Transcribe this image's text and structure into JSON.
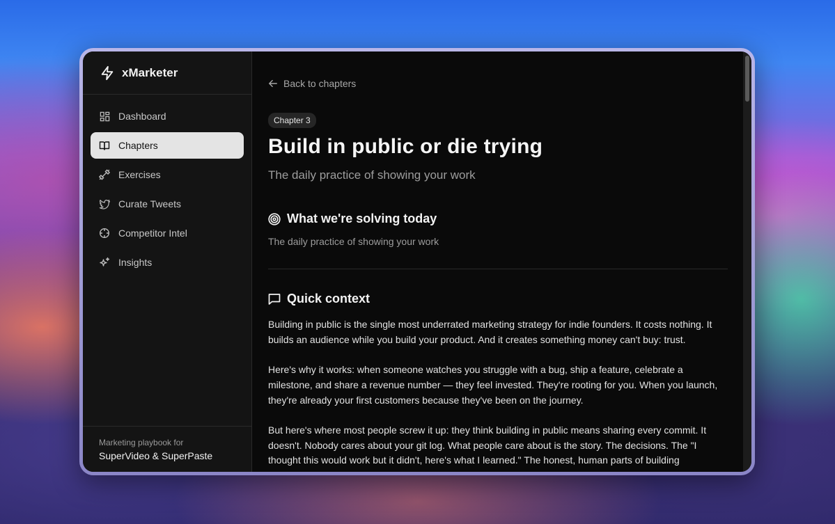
{
  "app": {
    "name": "xMarketer"
  },
  "sidebar": {
    "items": [
      {
        "label": "Dashboard",
        "icon": "dashboard-icon",
        "active": false
      },
      {
        "label": "Chapters",
        "icon": "book-icon",
        "active": true
      },
      {
        "label": "Exercises",
        "icon": "dumbbell-icon",
        "active": false
      },
      {
        "label": "Curate Tweets",
        "icon": "twitter-icon",
        "active": false
      },
      {
        "label": "Competitor Intel",
        "icon": "crosshair-icon",
        "active": false
      },
      {
        "label": "Insights",
        "icon": "sparkles-icon",
        "active": false
      }
    ],
    "footer": {
      "caption": "Marketing playbook for",
      "product": "SuperVideo & SuperPaste"
    }
  },
  "main": {
    "back_label": "Back to chapters",
    "chapter_badge": "Chapter 3",
    "title": "Build in public or die trying",
    "subtitle": "The daily practice of showing your work",
    "solving": {
      "heading": "What we're solving today",
      "text": "The daily practice of showing your work"
    },
    "context": {
      "heading": "Quick context",
      "paragraphs": [
        "Building in public is the single most underrated marketing strategy for indie founders. It costs nothing. It builds an audience while you build your product. And it creates something money can't buy: trust.",
        "Here's why it works: when someone watches you struggle with a bug, ship a feature, celebrate a milestone, and share a revenue number — they feel invested. They're rooting for you. When you launch, they're already your first customers because they've been on the journey.",
        "But here's where most people screw it up: they think building in public means sharing every commit. It doesn't. Nobody cares about your git log. What people care about is the story. The decisions. The \"I thought this would work but it didn't, here's what I learned.\" The honest, human parts of building something."
      ]
    }
  },
  "colors": {
    "window_bg": "#0a0a0a",
    "sidebar_bg": "#141414",
    "active_item_bg": "#e4e4e4",
    "text_primary": "#f5f5f5",
    "text_muted": "#9d9d9d"
  }
}
